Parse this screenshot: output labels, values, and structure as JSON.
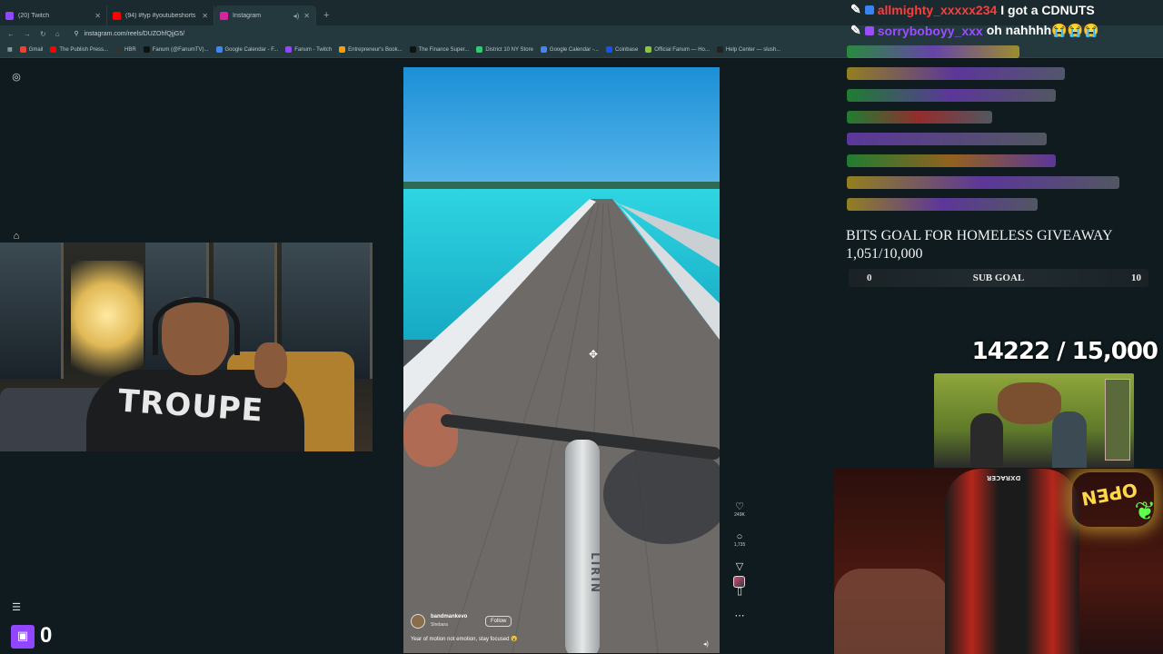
{
  "browser": {
    "tabs": [
      {
        "label": "(20) Twitch",
        "color": "#9146ff",
        "active": false
      },
      {
        "label": "(94) #fyp #youtubeshorts #sho",
        "color": "#ff0000",
        "active": false
      },
      {
        "label": "Instagram",
        "color": "#d6249f",
        "active": true
      }
    ],
    "url": "instagram.com/reels/DUZOhfQjjG5/",
    "bookmarks": [
      "Gmail",
      "The Publish Press...",
      "HBR",
      "Fanum (@FanumTV)...",
      "Google Calendar - F...",
      "Fanum - Twitch",
      "Entrepreneur's Book...",
      "The Finance Super...",
      "District 10 NY Store",
      "Google Calendar -...",
      "Coinbase",
      "Official Fanum — Ho...",
      "Help Center — slush..."
    ]
  },
  "reel": {
    "username": "bandmankevo",
    "location": "Shebara",
    "follow_label": "Follow",
    "caption": "Year of motion not emotion, stay focused 😮",
    "bike_label": "LIRIN",
    "actions": {
      "likes": "249K",
      "comments": "1,735"
    }
  },
  "stream": {
    "chat": [
      {
        "user": "allmighty_xxxxx234",
        "message": "I got a CDNUTS"
      },
      {
        "user": "sorryboboyy_xxx",
        "message": "oh nahhhh😭😭😭"
      }
    ],
    "bits_goal_title": "BITS GOAL FOR HOMELESS GIVEAWAY",
    "bits_goal_progress": "1,051/10,000",
    "sub_goal": {
      "label": "SUB GOAL",
      "min": "0",
      "max": "10"
    },
    "counter": "14222 / 15,000",
    "shirt_text": "TROUPE",
    "neon_sign": "OPEN",
    "chair_brand": "DXRACER",
    "viewer_count": "0"
  },
  "colors": {
    "accent_twitch": "#9146ff",
    "chat_user_1": "#ff3b3b",
    "chat_user_2": "#9b4dff"
  }
}
